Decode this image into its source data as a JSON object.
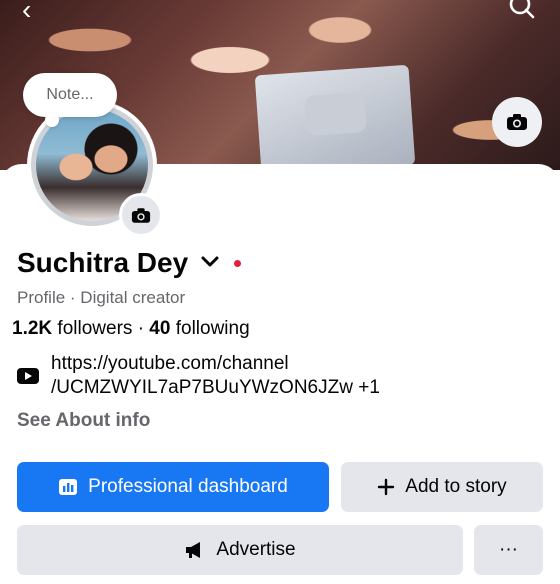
{
  "header": {
    "back_icon": "chevron-left-icon",
    "search_icon": "search-icon"
  },
  "profile": {
    "note_placeholder": "Note...",
    "name": "Suchitra Dey",
    "subtitle": "Profile · Digital creator",
    "followers_count": "1.2K",
    "followers_label": "followers",
    "separator": "·",
    "following_count": "40",
    "following_label": "following",
    "link_line1": "https://youtube.com/channel",
    "link_line2": "/UCMZWYIL7aP7BUuYWzON6JZw",
    "link_more": "+1",
    "see_about": "See About info",
    "status_dot_color": "#e41e3f"
  },
  "actions": {
    "dashboard_label": "Professional dashboard",
    "add_story_label": "Add to story",
    "advertise_label": "Advertise",
    "more_label": "···"
  },
  "colors": {
    "primary": "#1877f2",
    "secondary_bg": "#e4e6eb",
    "muted_text": "#65676b"
  }
}
